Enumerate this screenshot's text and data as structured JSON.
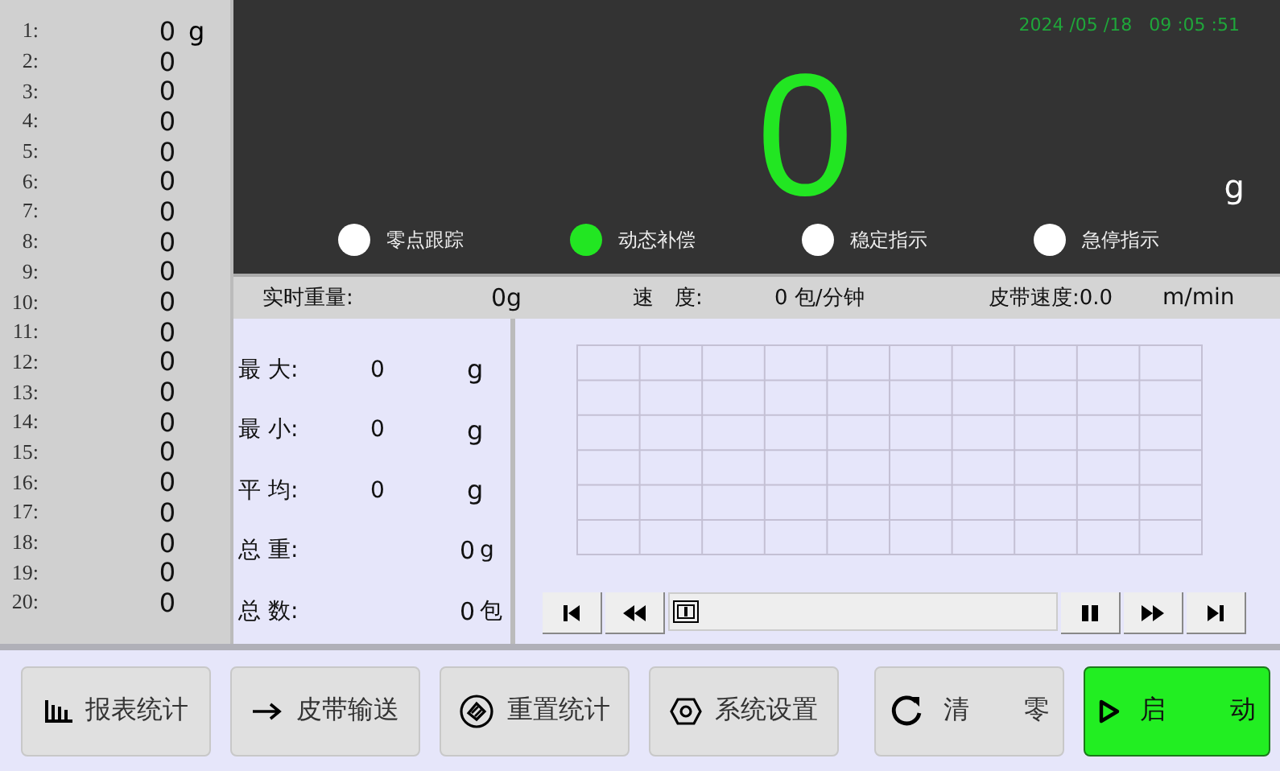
{
  "history": [
    {
      "index": "1:",
      "value": "0",
      "unit": "g"
    },
    {
      "index": "2:",
      "value": "0"
    },
    {
      "index": "3:",
      "value": "0"
    },
    {
      "index": "4:",
      "value": "0"
    },
    {
      "index": "5:",
      "value": "0"
    },
    {
      "index": "6:",
      "value": "0"
    },
    {
      "index": "7:",
      "value": "0"
    },
    {
      "index": "8:",
      "value": "0"
    },
    {
      "index": "9:",
      "value": "0"
    },
    {
      "index": "10:",
      "value": "0"
    },
    {
      "index": "11:",
      "value": "0"
    },
    {
      "index": "12:",
      "value": "0"
    },
    {
      "index": "13:",
      "value": "0"
    },
    {
      "index": "14:",
      "value": "0"
    },
    {
      "index": "15:",
      "value": "0"
    },
    {
      "index": "16:",
      "value": "0"
    },
    {
      "index": "17:",
      "value": "0"
    },
    {
      "index": "18:",
      "value": "0"
    },
    {
      "index": "19:",
      "value": "0"
    },
    {
      "index": "20:",
      "value": "0"
    }
  ],
  "display": {
    "datetime": "2024 /05 /18   09 :05 :51",
    "weight": "0",
    "unit": "g",
    "indicators": [
      {
        "label": "零点跟踪",
        "on": false
      },
      {
        "label": "动态补偿",
        "on": true
      },
      {
        "label": "稳定指示",
        "on": false
      },
      {
        "label": "急停指示",
        "on": false
      }
    ]
  },
  "status_bar": [
    {
      "label": "实时重量:",
      "value": "0g"
    },
    {
      "label": "速　度:",
      "value": "0 包/分钟"
    },
    {
      "label": "皮带速度:0.0",
      "value": "m/min"
    }
  ],
  "stats": [
    {
      "label": "最 大:",
      "value": "0",
      "unit": "g",
      "kind": "mid"
    },
    {
      "label": "最 小:",
      "value": "0",
      "unit": "g",
      "kind": "mid"
    },
    {
      "label": "平 均:",
      "value": "0",
      "unit": "g",
      "kind": "mid"
    },
    {
      "label": "总 重:",
      "value": "0",
      "unit": "g",
      "kind": "right"
    },
    {
      "label": "总 数:",
      "value": "0",
      "unit": "包",
      "kind": "right"
    }
  ],
  "buttons": [
    {
      "labels": [
        "报表统计"
      ],
      "kind": "normal"
    },
    {
      "labels": [
        "皮带输送"
      ],
      "kind": "normal"
    },
    {
      "labels": [
        "重置统计"
      ],
      "kind": "normal"
    },
    {
      "labels": [
        "系统设置"
      ],
      "kind": "normal"
    },
    {
      "labels": [
        "清",
        "零"
      ],
      "kind": "spread"
    },
    {
      "labels": [
        "启",
        "动"
      ],
      "kind": "primary"
    }
  ]
}
